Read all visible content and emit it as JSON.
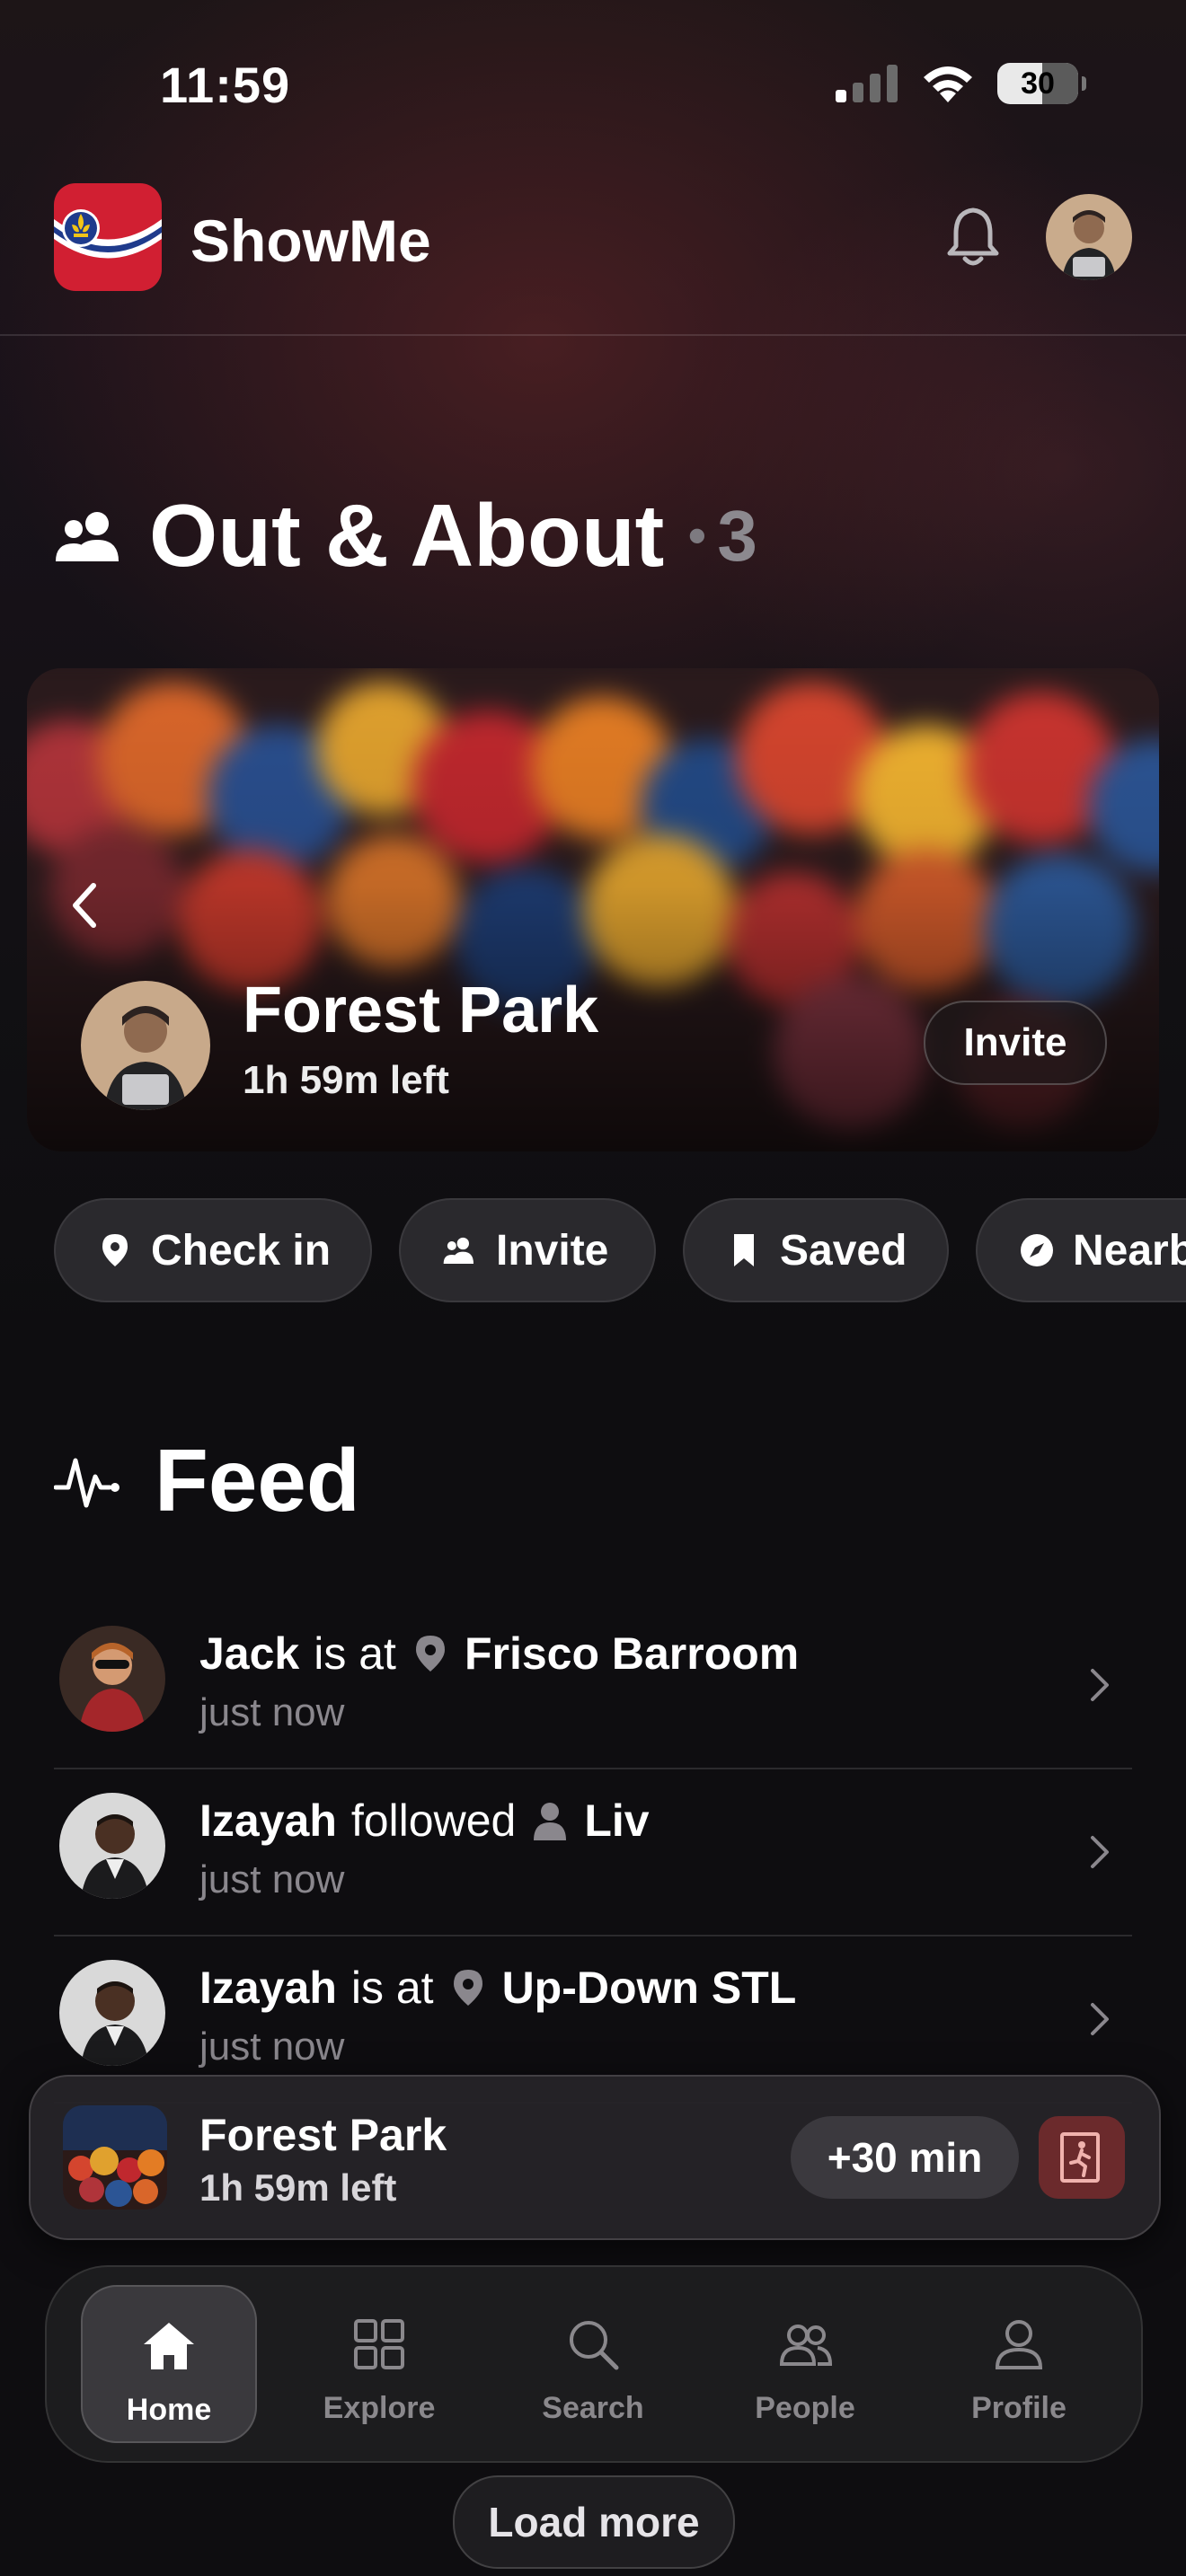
{
  "status_bar": {
    "time": "11:59",
    "battery": "30"
  },
  "header": {
    "app_name": "ShowMe"
  },
  "out_about": {
    "title": "Out & About",
    "separator": "•",
    "count": "3"
  },
  "hero": {
    "title": "Forest Park",
    "subtitle": "1h 59m left",
    "invite_label": "Invite"
  },
  "chips": [
    {
      "label": "Check in",
      "icon": "location-pin-icon"
    },
    {
      "label": "Invite",
      "icon": "people-icon"
    },
    {
      "label": "Saved",
      "icon": "bookmark-icon"
    },
    {
      "label": "Nearby",
      "icon": "compass-icon"
    }
  ],
  "feed": {
    "title": "Feed",
    "items": [
      {
        "name": "Jack",
        "verb": "is at",
        "target_icon": "location-pin-icon",
        "target": "Frisco Barroom",
        "time": "just now"
      },
      {
        "name": "Izayah",
        "verb": "followed",
        "target_icon": "person-icon",
        "target": "Liv",
        "time": "just now"
      },
      {
        "name": "Izayah",
        "verb": "is at",
        "target_icon": "location-pin-icon",
        "target": "Up-Down STL",
        "time": "just now"
      }
    ]
  },
  "now_bar": {
    "title": "Forest Park",
    "subtitle": "1h 59m left",
    "extend_label": "+30 min"
  },
  "tabs": [
    {
      "label": "Home",
      "icon": "home-icon",
      "active": true
    },
    {
      "label": "Explore",
      "icon": "grid-icon",
      "active": false
    },
    {
      "label": "Search",
      "icon": "search-icon",
      "active": false
    },
    {
      "label": "People",
      "icon": "people-icon",
      "active": false
    },
    {
      "label": "Profile",
      "icon": "person-icon",
      "active": false
    }
  ],
  "load_more_label": "Load more",
  "colors": {
    "background": "#0e0d10",
    "chip_bg": "#2a292d",
    "leave_button": "#6b2a2c",
    "muted_text": "#8a878d"
  }
}
